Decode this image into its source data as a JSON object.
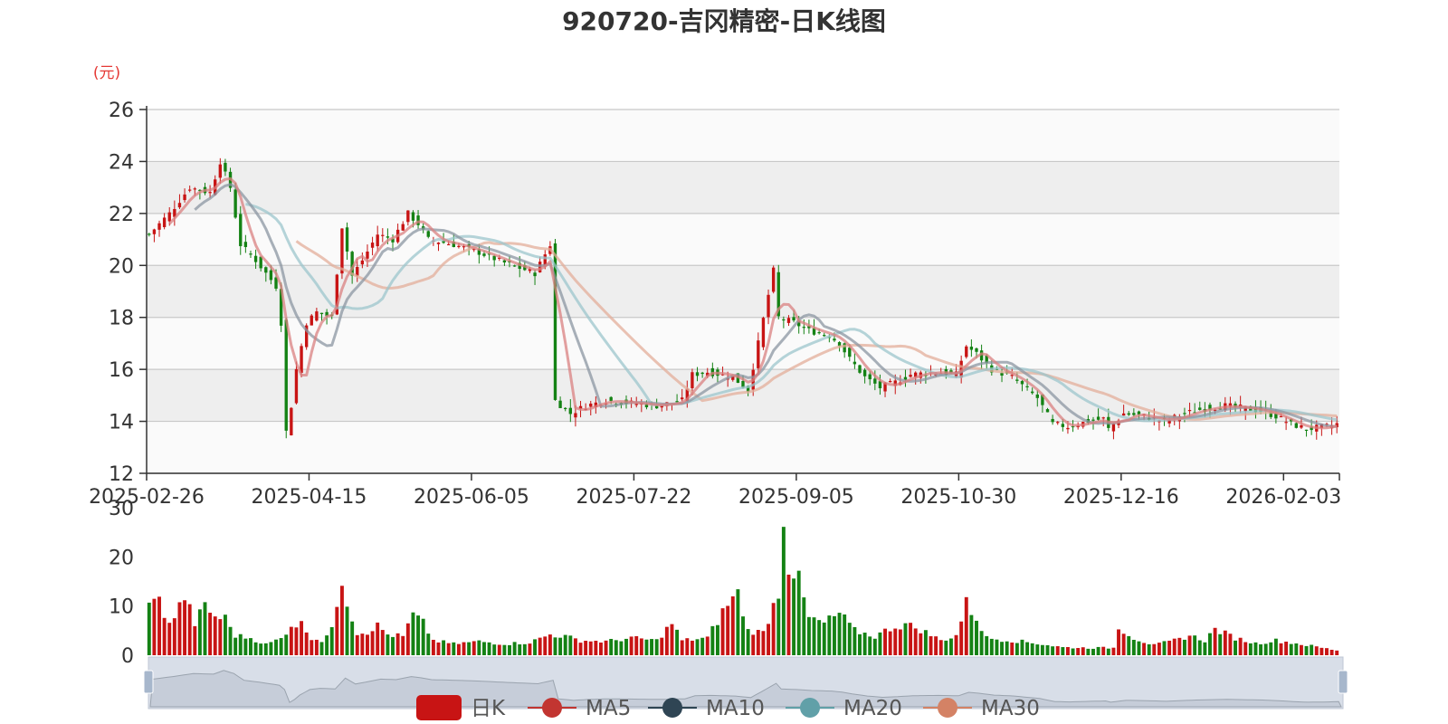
{
  "chart_data": [
    {
      "type": "candlestick",
      "title": "920720-吉冈精密-日K线图",
      "ylabel": "(元)",
      "ylim": [
        12,
        26
      ],
      "y_ticks": [
        "12",
        "14",
        "16",
        "18",
        "20",
        "22",
        "24",
        "26"
      ],
      "x_tick_labels": [
        "2025-02-26",
        "2025-04-15",
        "2025-06-05",
        "2025-07-22",
        "2025-09-05",
        "2025-10-30",
        "2025-12-16",
        "2026-02-03"
      ],
      "trading_days": 235,
      "x_tick_day_index": [
        0,
        32,
        64,
        96,
        128,
        160,
        192,
        224
      ],
      "colors": {
        "up": "#c81414",
        "down": "#148214",
        "MA5": "#d98080",
        "MA10": "#8b96a2",
        "MA20": "#9cc6cc",
        "MA30": "#e3ad9a"
      },
      "close_keypoints": [
        [
          0,
          21.2
        ],
        [
          4,
          22.0
        ],
        [
          8,
          23.0
        ],
        [
          12,
          22.8
        ],
        [
          14,
          24.0
        ],
        [
          16,
          23.0
        ],
        [
          18,
          20.8
        ],
        [
          21,
          20.2
        ],
        [
          25,
          19.2
        ],
        [
          26,
          17.8
        ],
        [
          27,
          13.6
        ],
        [
          28,
          14.6
        ],
        [
          29,
          16.0
        ],
        [
          31,
          17.8
        ],
        [
          33,
          18.2
        ],
        [
          36,
          18.0
        ],
        [
          38,
          21.5
        ],
        [
          40,
          19.6
        ],
        [
          42,
          20.2
        ],
        [
          45,
          21.2
        ],
        [
          48,
          21.0
        ],
        [
          51,
          22.0
        ],
        [
          53,
          21.6
        ],
        [
          55,
          21.0
        ],
        [
          60,
          20.8
        ],
        [
          65,
          20.5
        ],
        [
          70,
          20.1
        ],
        [
          73,
          19.9
        ],
        [
          76,
          19.7
        ],
        [
          79,
          20.8
        ],
        [
          80,
          14.8
        ],
        [
          83,
          14.3
        ],
        [
          86,
          14.6
        ],
        [
          90,
          14.8
        ],
        [
          95,
          14.7
        ],
        [
          100,
          14.6
        ],
        [
          105,
          14.8
        ],
        [
          107,
          15.8
        ],
        [
          110,
          15.9
        ],
        [
          115,
          15.7
        ],
        [
          118,
          15.2
        ],
        [
          120,
          17.0
        ],
        [
          123,
          19.8
        ],
        [
          124,
          18.0
        ],
        [
          127,
          17.8
        ],
        [
          130,
          17.5
        ],
        [
          134,
          17.3
        ],
        [
          136,
          17.0
        ],
        [
          138,
          16.4
        ],
        [
          141,
          15.7
        ],
        [
          144,
          15.3
        ],
        [
          147,
          15.5
        ],
        [
          150,
          15.8
        ],
        [
          155,
          15.9
        ],
        [
          159,
          15.8
        ],
        [
          161,
          16.9
        ],
        [
          163,
          16.6
        ],
        [
          166,
          16.0
        ],
        [
          170,
          15.7
        ],
        [
          175,
          14.9
        ],
        [
          178,
          13.9
        ],
        [
          181,
          13.8
        ],
        [
          185,
          14.0
        ],
        [
          188,
          14.1
        ],
        [
          189,
          13.7
        ],
        [
          192,
          14.3
        ],
        [
          196,
          14.2
        ],
        [
          200,
          14.0
        ],
        [
          204,
          14.3
        ],
        [
          208,
          14.5
        ],
        [
          212,
          14.6
        ],
        [
          216,
          14.5
        ],
        [
          219,
          14.4
        ],
        [
          222,
          14.2
        ],
        [
          225,
          13.9
        ],
        [
          228,
          13.7
        ],
        [
          232,
          13.8
        ],
        [
          234,
          13.9
        ]
      ],
      "volume_ylim": [
        0,
        30
      ],
      "volume_ticks": [
        "0",
        "10",
        "20",
        "30"
      ],
      "volume_keypoints": [
        [
          0,
          10
        ],
        [
          1,
          13
        ],
        [
          2,
          11
        ],
        [
          3,
          7
        ],
        [
          5,
          7.8
        ],
        [
          7,
          12
        ],
        [
          9,
          6.5
        ],
        [
          11,
          10
        ],
        [
          13,
          7.8
        ],
        [
          15,
          7.5
        ],
        [
          17,
          4
        ],
        [
          20,
          3.5
        ],
        [
          23,
          2.2
        ],
        [
          26,
          3.4
        ],
        [
          28,
          6.2
        ],
        [
          30,
          6.3
        ],
        [
          32,
          3.6
        ],
        [
          34,
          3.0
        ],
        [
          36,
          5.0
        ],
        [
          38,
          16
        ],
        [
          39,
          11
        ],
        [
          41,
          4.5
        ],
        [
          43,
          4.8
        ],
        [
          45,
          6.0
        ],
        [
          47,
          4.2
        ],
        [
          50,
          3.8
        ],
        [
          52,
          8.2
        ],
        [
          54,
          6.5
        ],
        [
          56,
          3.0
        ],
        [
          60,
          2.3
        ],
        [
          65,
          2.8
        ],
        [
          70,
          2.3
        ],
        [
          75,
          2.6
        ],
        [
          79,
          4.2
        ],
        [
          82,
          3.8
        ],
        [
          85,
          3.0
        ],
        [
          90,
          2.8
        ],
        [
          95,
          3.5
        ],
        [
          100,
          3.0
        ],
        [
          103,
          6.5
        ],
        [
          105,
          3.0
        ],
        [
          110,
          3.5
        ],
        [
          114,
          10.5
        ],
        [
          116,
          12.5
        ],
        [
          118,
          5.0
        ],
        [
          121,
          4.6
        ],
        [
          124,
          13.0
        ],
        [
          125,
          28.5
        ],
        [
          126,
          18.5
        ],
        [
          128,
          15
        ],
        [
          130,
          7.5
        ],
        [
          133,
          6.5
        ],
        [
          136,
          8.5
        ],
        [
          139,
          5.0
        ],
        [
          143,
          3.8
        ],
        [
          146,
          5.5
        ],
        [
          149,
          6.3
        ],
        [
          152,
          5.2
        ],
        [
          156,
          3.0
        ],
        [
          159,
          4.0
        ],
        [
          161,
          10.5
        ],
        [
          163,
          7.5
        ],
        [
          165,
          3.5
        ],
        [
          170,
          3.0
        ],
        [
          175,
          2.4
        ],
        [
          180,
          1.6
        ],
        [
          185,
          1.5
        ],
        [
          190,
          1.5
        ],
        [
          191,
          5.8
        ],
        [
          194,
          3.5
        ],
        [
          198,
          2.0
        ],
        [
          202,
          3.0
        ],
        [
          205,
          4.0
        ],
        [
          208,
          3.0
        ],
        [
          210,
          5.3
        ],
        [
          214,
          3.5
        ],
        [
          218,
          2.4
        ],
        [
          222,
          3.0
        ],
        [
          226,
          2.4
        ],
        [
          230,
          1.7
        ],
        [
          234,
          1.0
        ]
      ],
      "legend": [
        {
          "name": "日K",
          "color": "#c81414"
        },
        {
          "name": "MA5",
          "color": "#c23531"
        },
        {
          "name": "MA10",
          "color": "#2f4554"
        },
        {
          "name": "MA20",
          "color": "#61a0a8"
        },
        {
          "name": "MA30",
          "color": "#d48265"
        }
      ],
      "grid": true,
      "legend_position": "bottom",
      "datazoom_range": [
        0,
        100
      ]
    }
  ]
}
